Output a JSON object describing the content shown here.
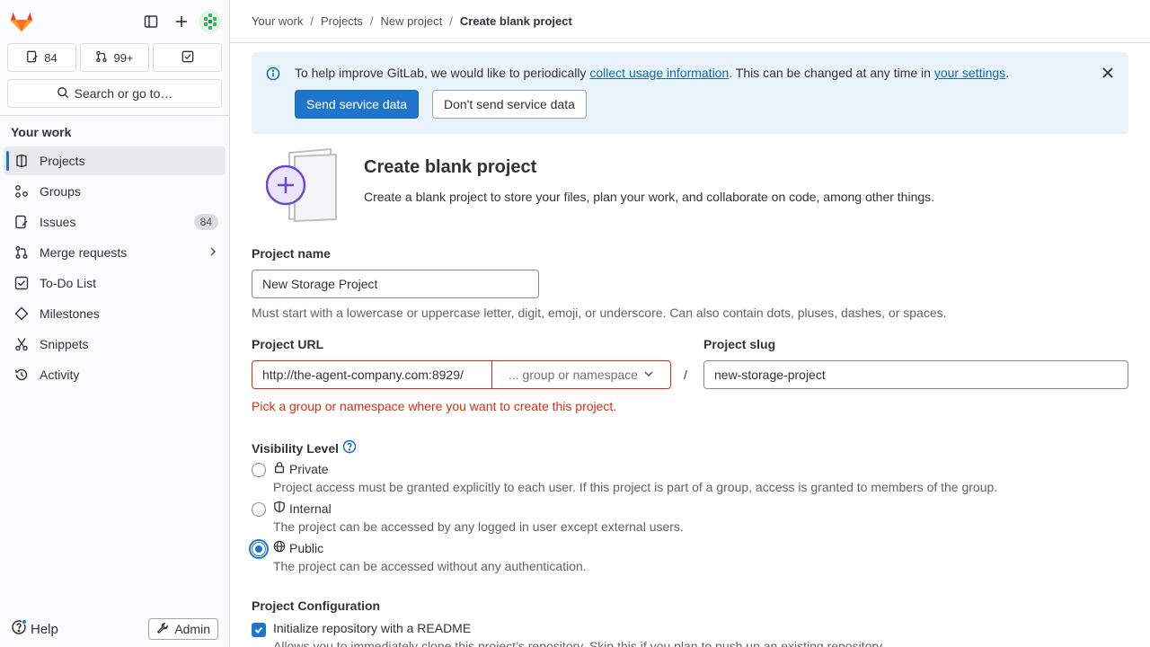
{
  "sidebar": {
    "counters": {
      "issues": "84",
      "merge_requests": "99+"
    },
    "search_label": "Search or go to…",
    "section_title": "Your work",
    "items": [
      {
        "label": "Projects",
        "icon": "project-icon",
        "active": true
      },
      {
        "label": "Groups",
        "icon": "group-icon"
      },
      {
        "label": "Issues",
        "icon": "issues-icon",
        "badge": "84"
      },
      {
        "label": "Merge requests",
        "icon": "merge-request-icon",
        "chevron": true
      },
      {
        "label": "To-Do List",
        "icon": "todo-icon"
      },
      {
        "label": "Milestones",
        "icon": "milestone-icon"
      },
      {
        "label": "Snippets",
        "icon": "snippet-icon"
      },
      {
        "label": "Activity",
        "icon": "history-icon"
      }
    ],
    "help_label": "Help",
    "admin_label": "Admin"
  },
  "breadcrumb": [
    "Your work",
    "Projects",
    "New project",
    "Create blank project"
  ],
  "banner": {
    "text_before": "To help improve GitLab, we would like to periodically ",
    "link1": "collect usage information",
    "text_middle": ". This can be changed at any time in ",
    "link2": "your settings",
    "text_after": ".",
    "primary_button": "Send service data",
    "secondary_button": "Don't send service data"
  },
  "hero": {
    "title": "Create blank project",
    "description": "Create a blank project to store your files, plan your work, and collaborate on code, among other things."
  },
  "form": {
    "project_name_label": "Project name",
    "project_name_value": "New Storage Project",
    "project_name_hint": "Must start with a lowercase or uppercase letter, digit, emoji, or underscore. Can also contain dots, pluses, dashes, or spaces.",
    "project_url_label": "Project URL",
    "project_url_prefix": "http://the-agent-company.com:8929/",
    "namespace_placeholder": "... group or namespace",
    "slash": "/",
    "project_slug_label": "Project slug",
    "project_slug_value": "new-storage-project",
    "namespace_error": "Pick a group or namespace where you want to create this project.",
    "visibility_label": "Visibility Level",
    "visibility": [
      {
        "title": "Private",
        "desc": "Project access must be granted explicitly to each user. If this project is part of a group, access is granted to members of the group.",
        "checked": false
      },
      {
        "title": "Internal",
        "desc": "The project can be accessed by any logged in user except external users.",
        "checked": false
      },
      {
        "title": "Public",
        "desc": "The project can be accessed without any authentication.",
        "checked": true
      }
    ],
    "config_label": "Project Configuration",
    "readme_label": "Initialize repository with a README",
    "readme_desc": "Allows you to immediately clone this project’s repository. Skip this if you plan to push up an existing repository."
  },
  "colors": {
    "accent": "#1f75cb",
    "error": "#dd2b0e",
    "banner_bg": "#e9f3fc"
  }
}
